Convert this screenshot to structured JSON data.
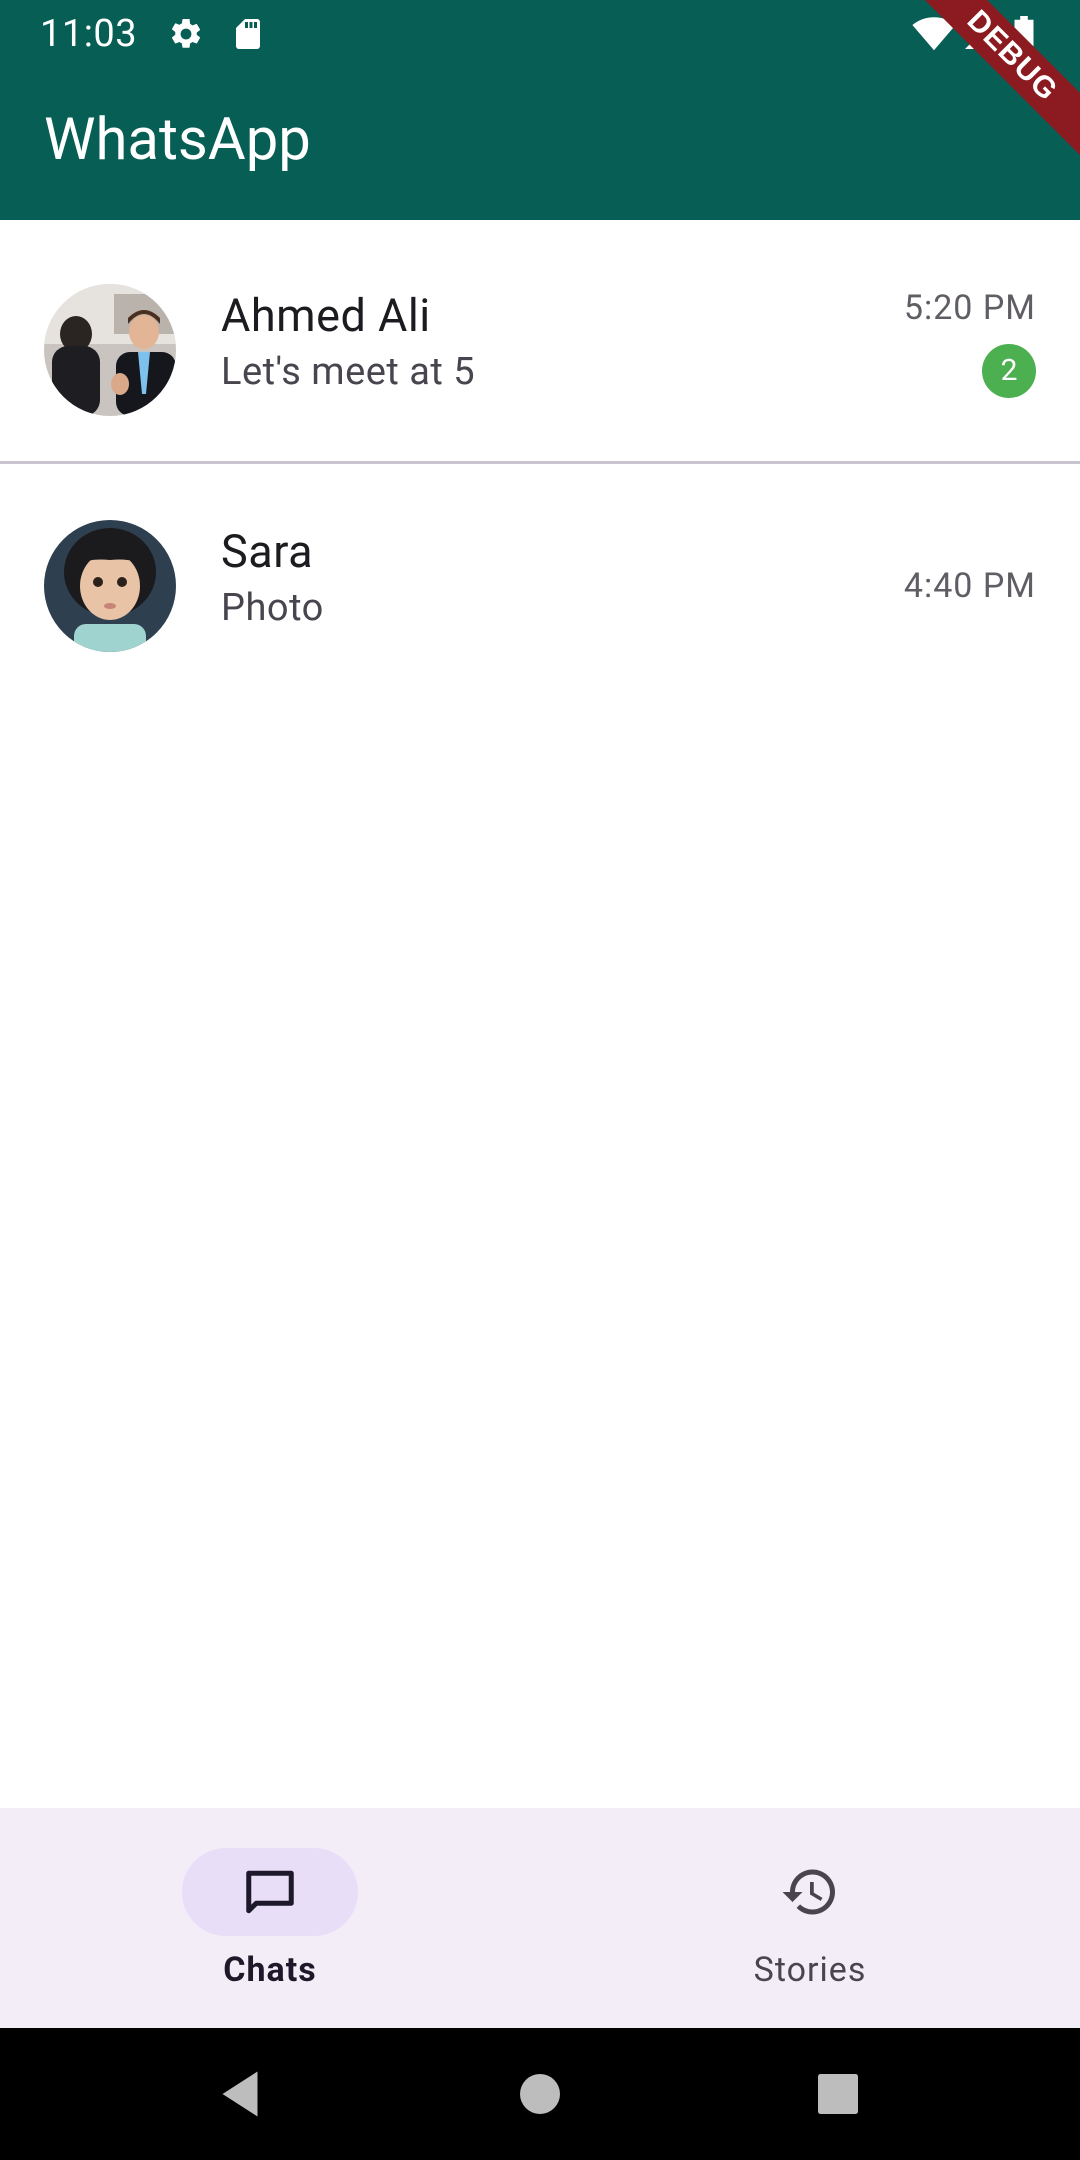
{
  "status_bar": {
    "time": "11:03",
    "left_icons": [
      "gear-icon",
      "sd-card-icon"
    ],
    "right_icons": [
      "wifi-icon",
      "signal-icon",
      "battery-icon"
    ]
  },
  "app_bar": {
    "title": "WhatsApp",
    "background": "#075E54"
  },
  "debug_banner": {
    "label": "DEBUG"
  },
  "chats": [
    {
      "name": "Ahmed Ali",
      "last_message": "Let's meet at 5",
      "time": "5:20 PM",
      "unread_count": "2",
      "avatar": "photo of two men"
    },
    {
      "name": "Sara",
      "last_message": "Photo",
      "time": "4:40 PM",
      "unread_count": null,
      "avatar": "photo of a child"
    }
  ],
  "bottom_nav": {
    "items": [
      {
        "label": "Chats",
        "icon": "chat-bubble-icon",
        "active": true
      },
      {
        "label": "Stories",
        "icon": "history-icon",
        "active": false
      }
    ]
  },
  "system_nav": {
    "buttons": [
      "back-icon",
      "home-icon",
      "recents-icon"
    ]
  },
  "colors": {
    "accent": "#075E54",
    "unread_badge": "#4CAF50",
    "nav_background": "#F3EDF7",
    "nav_active_pill": "#E8DEF8"
  }
}
